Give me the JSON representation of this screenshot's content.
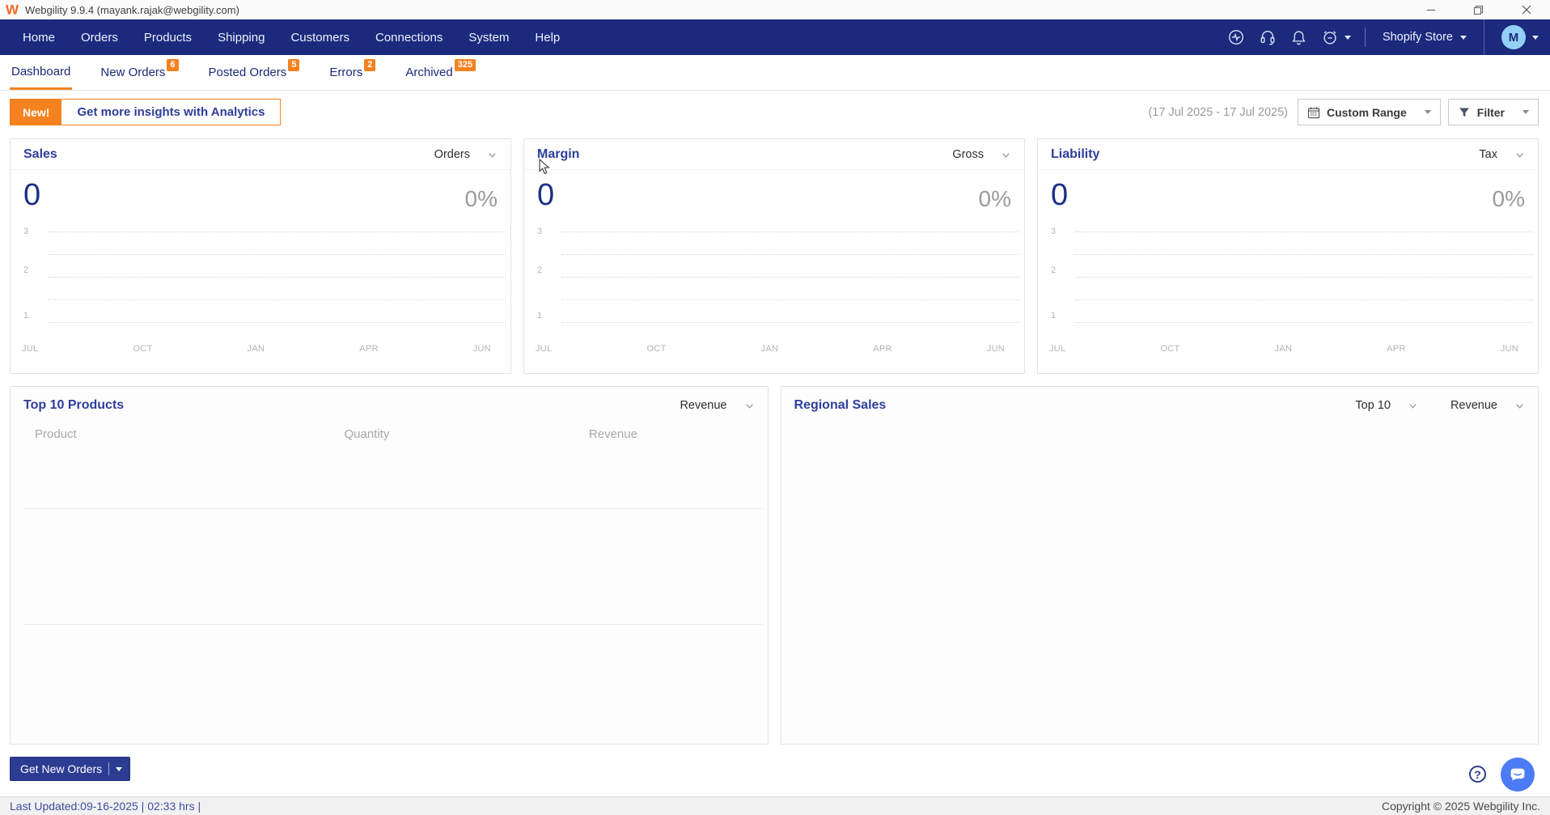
{
  "window": {
    "title": "Webgility 9.9.4 (mayank.rajak@webgility.com)",
    "logo": "W"
  },
  "nav": {
    "items": [
      "Home",
      "Orders",
      "Products",
      "Shipping",
      "Customers",
      "Connections",
      "System",
      "Help"
    ],
    "store_selector": "Shopify Store",
    "avatar_initial": "M"
  },
  "tabs": [
    {
      "label": "Dashboard",
      "active": true
    },
    {
      "label": "New Orders",
      "badge": "6"
    },
    {
      "label": "Posted Orders",
      "badge": "5"
    },
    {
      "label": "Errors",
      "badge": "2"
    },
    {
      "label": "Archived",
      "badge": "325"
    }
  ],
  "toolbar": {
    "new_badge": "New!",
    "banner_text": "Get more insights with Analytics",
    "date_range": "(17 Jul 2025 - 17 Jul 2025)",
    "custom_range_label": "Custom Range",
    "filter_label": "Filter"
  },
  "chart_cards": [
    {
      "title": "Sales",
      "dropdown": "Orders",
      "value": "0",
      "percent": "0%"
    },
    {
      "title": "Margin",
      "dropdown": "Gross",
      "value": "0",
      "percent": "0%"
    },
    {
      "title": "Liability",
      "dropdown": "Tax",
      "value": "0",
      "percent": "0%"
    }
  ],
  "chart_axis": {
    "y_labels": [
      "3",
      "2",
      "1"
    ],
    "x_labels": [
      "JUL",
      "OCT",
      "JAN",
      "APR",
      "JUN"
    ]
  },
  "chart_data": [
    {
      "type": "line",
      "title": "Sales",
      "metric": "Orders",
      "x": [
        "JUL",
        "OCT",
        "JAN",
        "APR",
        "JUN"
      ],
      "series": [],
      "ylim": [
        0,
        3
      ],
      "y_ticks": [
        1,
        2,
        3
      ],
      "grid": "dotted-horizontal",
      "value": 0,
      "percent": 0
    },
    {
      "type": "line",
      "title": "Margin",
      "metric": "Gross",
      "x": [
        "JUL",
        "OCT",
        "JAN",
        "APR",
        "JUN"
      ],
      "series": [],
      "ylim": [
        0,
        3
      ],
      "y_ticks": [
        1,
        2,
        3
      ],
      "grid": "dotted-horizontal",
      "value": 0,
      "percent": 0
    },
    {
      "type": "line",
      "title": "Liability",
      "metric": "Tax",
      "x": [
        "JUL",
        "OCT",
        "JAN",
        "APR",
        "JUN"
      ],
      "series": [],
      "ylim": [
        0,
        3
      ],
      "y_ticks": [
        1,
        2,
        3
      ],
      "grid": "dotted-horizontal",
      "value": 0,
      "percent": 0
    }
  ],
  "products_panel": {
    "title": "Top 10 Products",
    "dropdown": "Revenue",
    "columns": [
      "Product",
      "Quantity",
      "Revenue"
    ],
    "rows": []
  },
  "regional_panel": {
    "title": "Regional Sales",
    "dropdown_top": "Top 10",
    "dropdown_metric": "Revenue"
  },
  "footer": {
    "get_new_orders": "Get New Orders",
    "last_updated": "Last Updated:09-16-2025 | 02:33 hrs |",
    "copyright": "Copyright © 2025 Webgility Inc."
  },
  "colors": {
    "nav_navy": "#1b2a7d",
    "accent_orange": "#f5821f",
    "title_blue": "#2d3e9c",
    "value_blue": "#1c2f87",
    "chat_blue": "#4b7bf5",
    "avatar_blue": "#92d0f5"
  }
}
